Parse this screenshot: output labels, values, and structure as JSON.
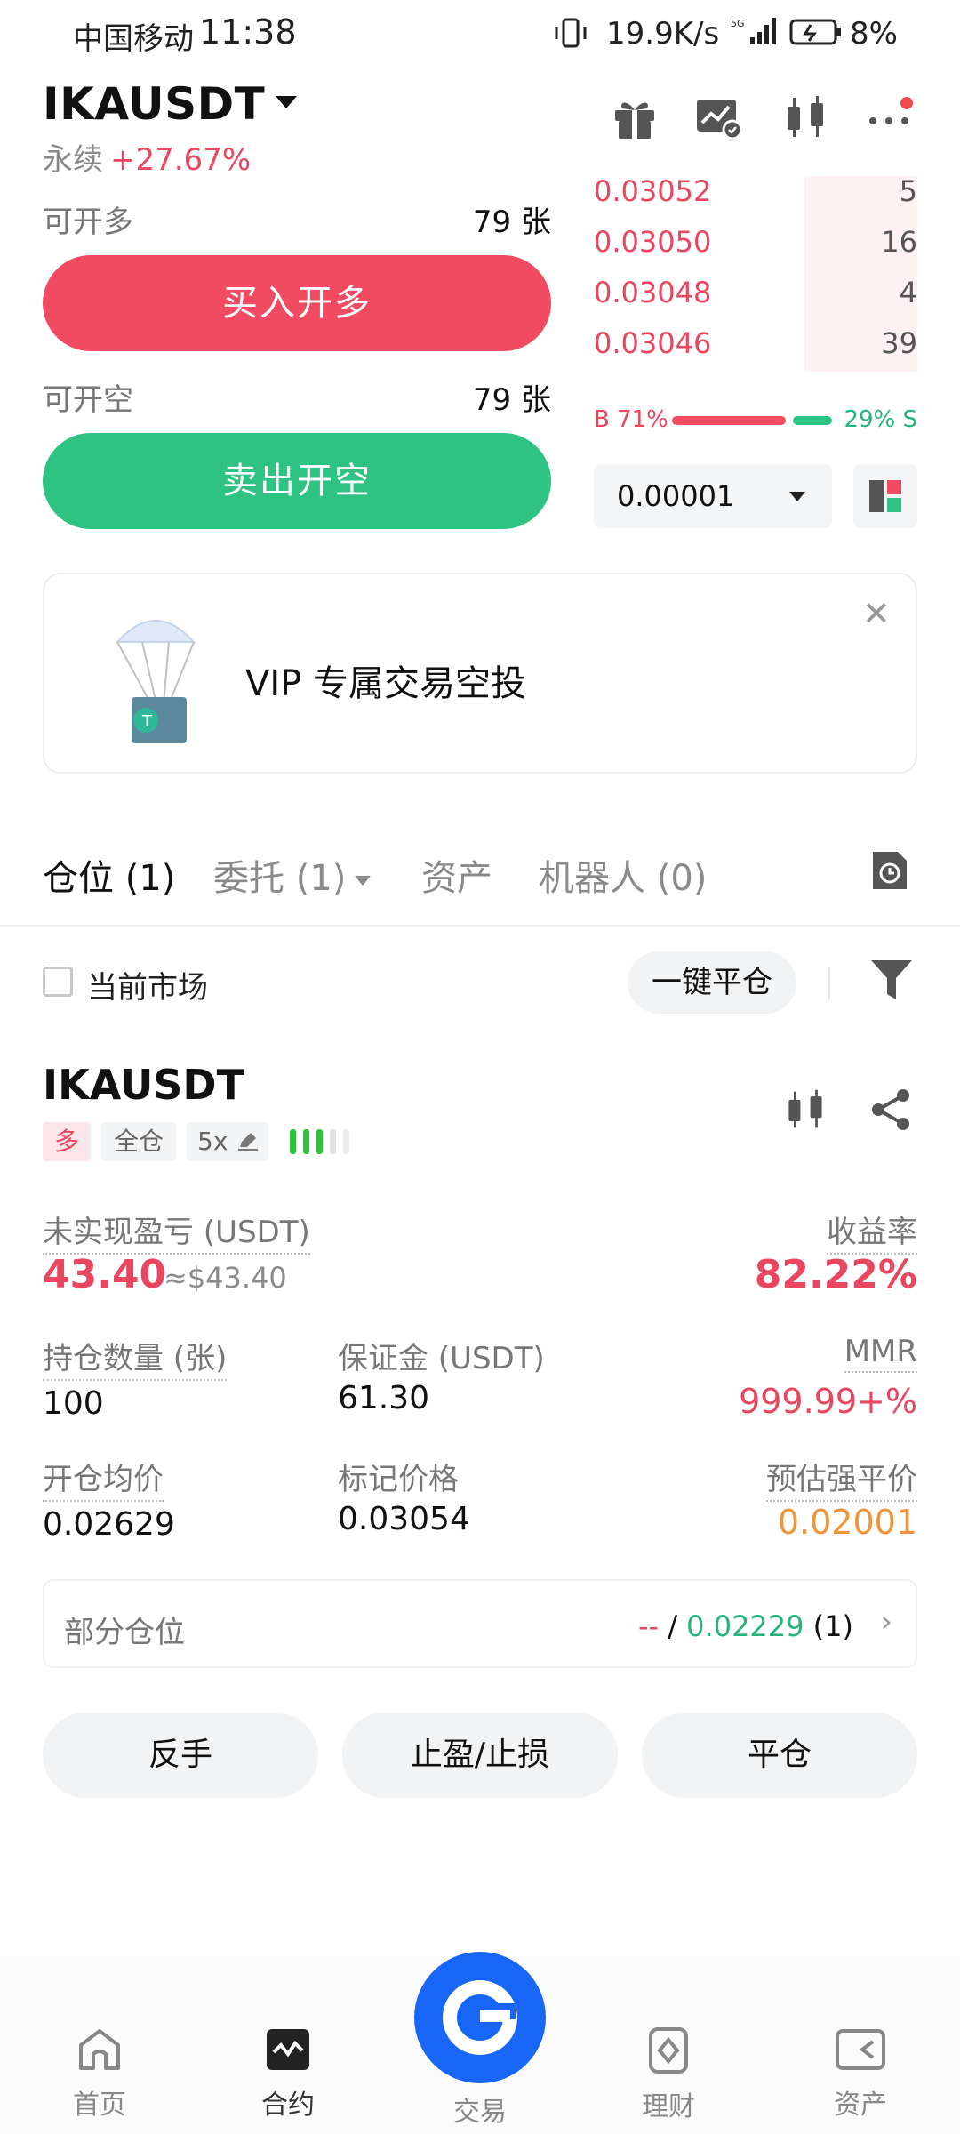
{
  "status_bar": {
    "carrier": "中国移动",
    "time": "11:38",
    "speed": "19.9K/s",
    "battery": "8%"
  },
  "header": {
    "symbol": "IKAUSDT",
    "contract_type": "永续",
    "change_pct": "+27.67%"
  },
  "order_panel": {
    "long_label": "可开多",
    "long_qty": "79 张",
    "buy_button": "买入开多",
    "short_label": "可开空",
    "short_qty": "79 张",
    "sell_button": "卖出开空"
  },
  "order_book": {
    "asks": [
      {
        "price": "0.03052",
        "qty": "5"
      },
      {
        "price": "0.03050",
        "qty": "16"
      },
      {
        "price": "0.03048",
        "qty": "4"
      },
      {
        "price": "0.03046",
        "qty": "39"
      }
    ],
    "buy_ratio": "B 71%",
    "sell_ratio": "29% S",
    "buy_fraction": 0.71,
    "precision": "0.00001"
  },
  "promo": {
    "text": "VIP 专属交易空投"
  },
  "tabs": [
    {
      "label": "仓位 (1)"
    },
    {
      "label": "委托 (1)"
    },
    {
      "label": "资产"
    },
    {
      "label": "机器人 (0)"
    }
  ],
  "filter": {
    "current_market": "当前市场",
    "close_all": "一键平仓"
  },
  "position": {
    "symbol": "IKAUSDT",
    "side_tag": "多",
    "margin_mode_tag": "全仓",
    "leverage_tag": "5x",
    "unrealized_pnl_label": "未实现盈亏 (USDT)",
    "unrealized_pnl": "43.40",
    "unrealized_pnl_usd": "≈$43.40",
    "roi_label": "收益率",
    "roi": "82.22%",
    "size_label": "持仓数量 (张)",
    "size": "100",
    "margin_label": "保证金 (USDT)",
    "margin": "61.30",
    "mmr_label": "MMR",
    "mmr": "999.99+%",
    "entry_label": "开仓均价",
    "entry": "0.02629",
    "mark_label": "标记价格",
    "mark": "0.03054",
    "liq_label": "预估强平价",
    "liq": "0.02001",
    "partial_label": "部分仓位",
    "partial_tp": "--",
    "partial_sep": "/",
    "partial_sl": "0.02229",
    "partial_count": "(1)"
  },
  "actions": {
    "reverse": "反手",
    "tp_sl": "止盈/止损",
    "close": "平仓"
  },
  "bottom_nav": [
    {
      "label": "首页",
      "icon": "home-icon"
    },
    {
      "label": "合约",
      "icon": "contract-icon"
    },
    {
      "label": "交易",
      "icon": "trade-icon"
    },
    {
      "label": "理财",
      "icon": "finance-icon"
    },
    {
      "label": "资产",
      "icon": "assets-icon"
    }
  ],
  "colors": {
    "buy": "#f04b62",
    "sell": "#2ec382",
    "accent": "#1766f5",
    "liq": "#f0953a"
  }
}
